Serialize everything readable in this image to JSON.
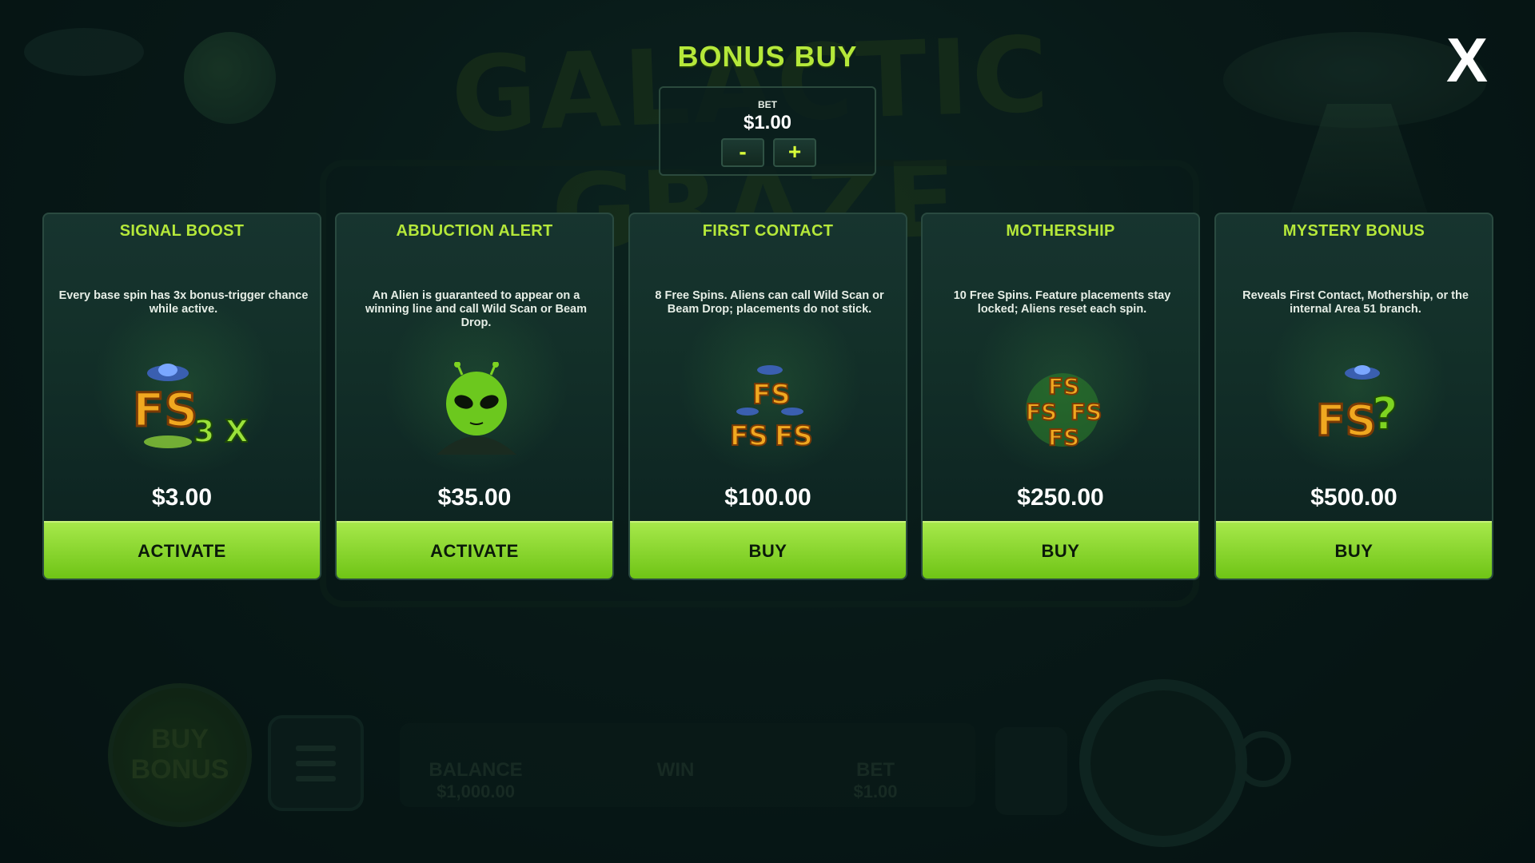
{
  "background": {
    "game_title": "GALACTIC GRAZE",
    "buy_bonus_label": "BUY BONUS",
    "stats": [
      {
        "label": "BALANCE",
        "value": "$1,000.00"
      },
      {
        "label": "WIN",
        "value": ""
      },
      {
        "label": "BET",
        "value": "$1.00"
      }
    ]
  },
  "header": {
    "title": "BONUS BUY",
    "close_label": "X"
  },
  "bet": {
    "label": "BET",
    "value": "$1.00",
    "minus_label": "-",
    "plus_label": "+"
  },
  "colors": {
    "accent": "#b5e83a",
    "button_green": "#8fd630",
    "panel_bg": "#133029"
  },
  "cards": [
    {
      "title": "SIGNAL BOOST",
      "description": "Every base spin has 3x bonus-trigger chance while active.",
      "icon": "fs-3x-icon",
      "icon_text": "FS",
      "icon_extra": "3 X",
      "price": "$3.00",
      "button": "ACTIVATE"
    },
    {
      "title": "ABDUCTION ALERT",
      "description": "An Alien is guaranteed to appear on a winning line and call Wild Scan or Beam Drop.",
      "icon": "alien-icon",
      "price": "$35.00",
      "button": "ACTIVATE"
    },
    {
      "title": "FIRST CONTACT",
      "description": "8 Free Spins. Aliens can call Wild Scan or Beam Drop; placements do not stick.",
      "icon": "fs-triple-icon",
      "icon_text": "FS",
      "price": "$100.00",
      "button": "BUY"
    },
    {
      "title": "MOTHERSHIP",
      "description": "10 Free Spins. Feature placements stay locked; Aliens reset each spin.",
      "icon": "fs-quad-icon",
      "icon_text": "FS",
      "price": "$250.00",
      "button": "BUY"
    },
    {
      "title": "MYSTERY BONUS",
      "description": "Reveals First Contact, Mothership, or the internal Area 51 branch.",
      "icon": "fs-mystery-icon",
      "icon_text": "FS",
      "icon_extra": "?",
      "price": "$500.00",
      "button": "BUY"
    }
  ]
}
